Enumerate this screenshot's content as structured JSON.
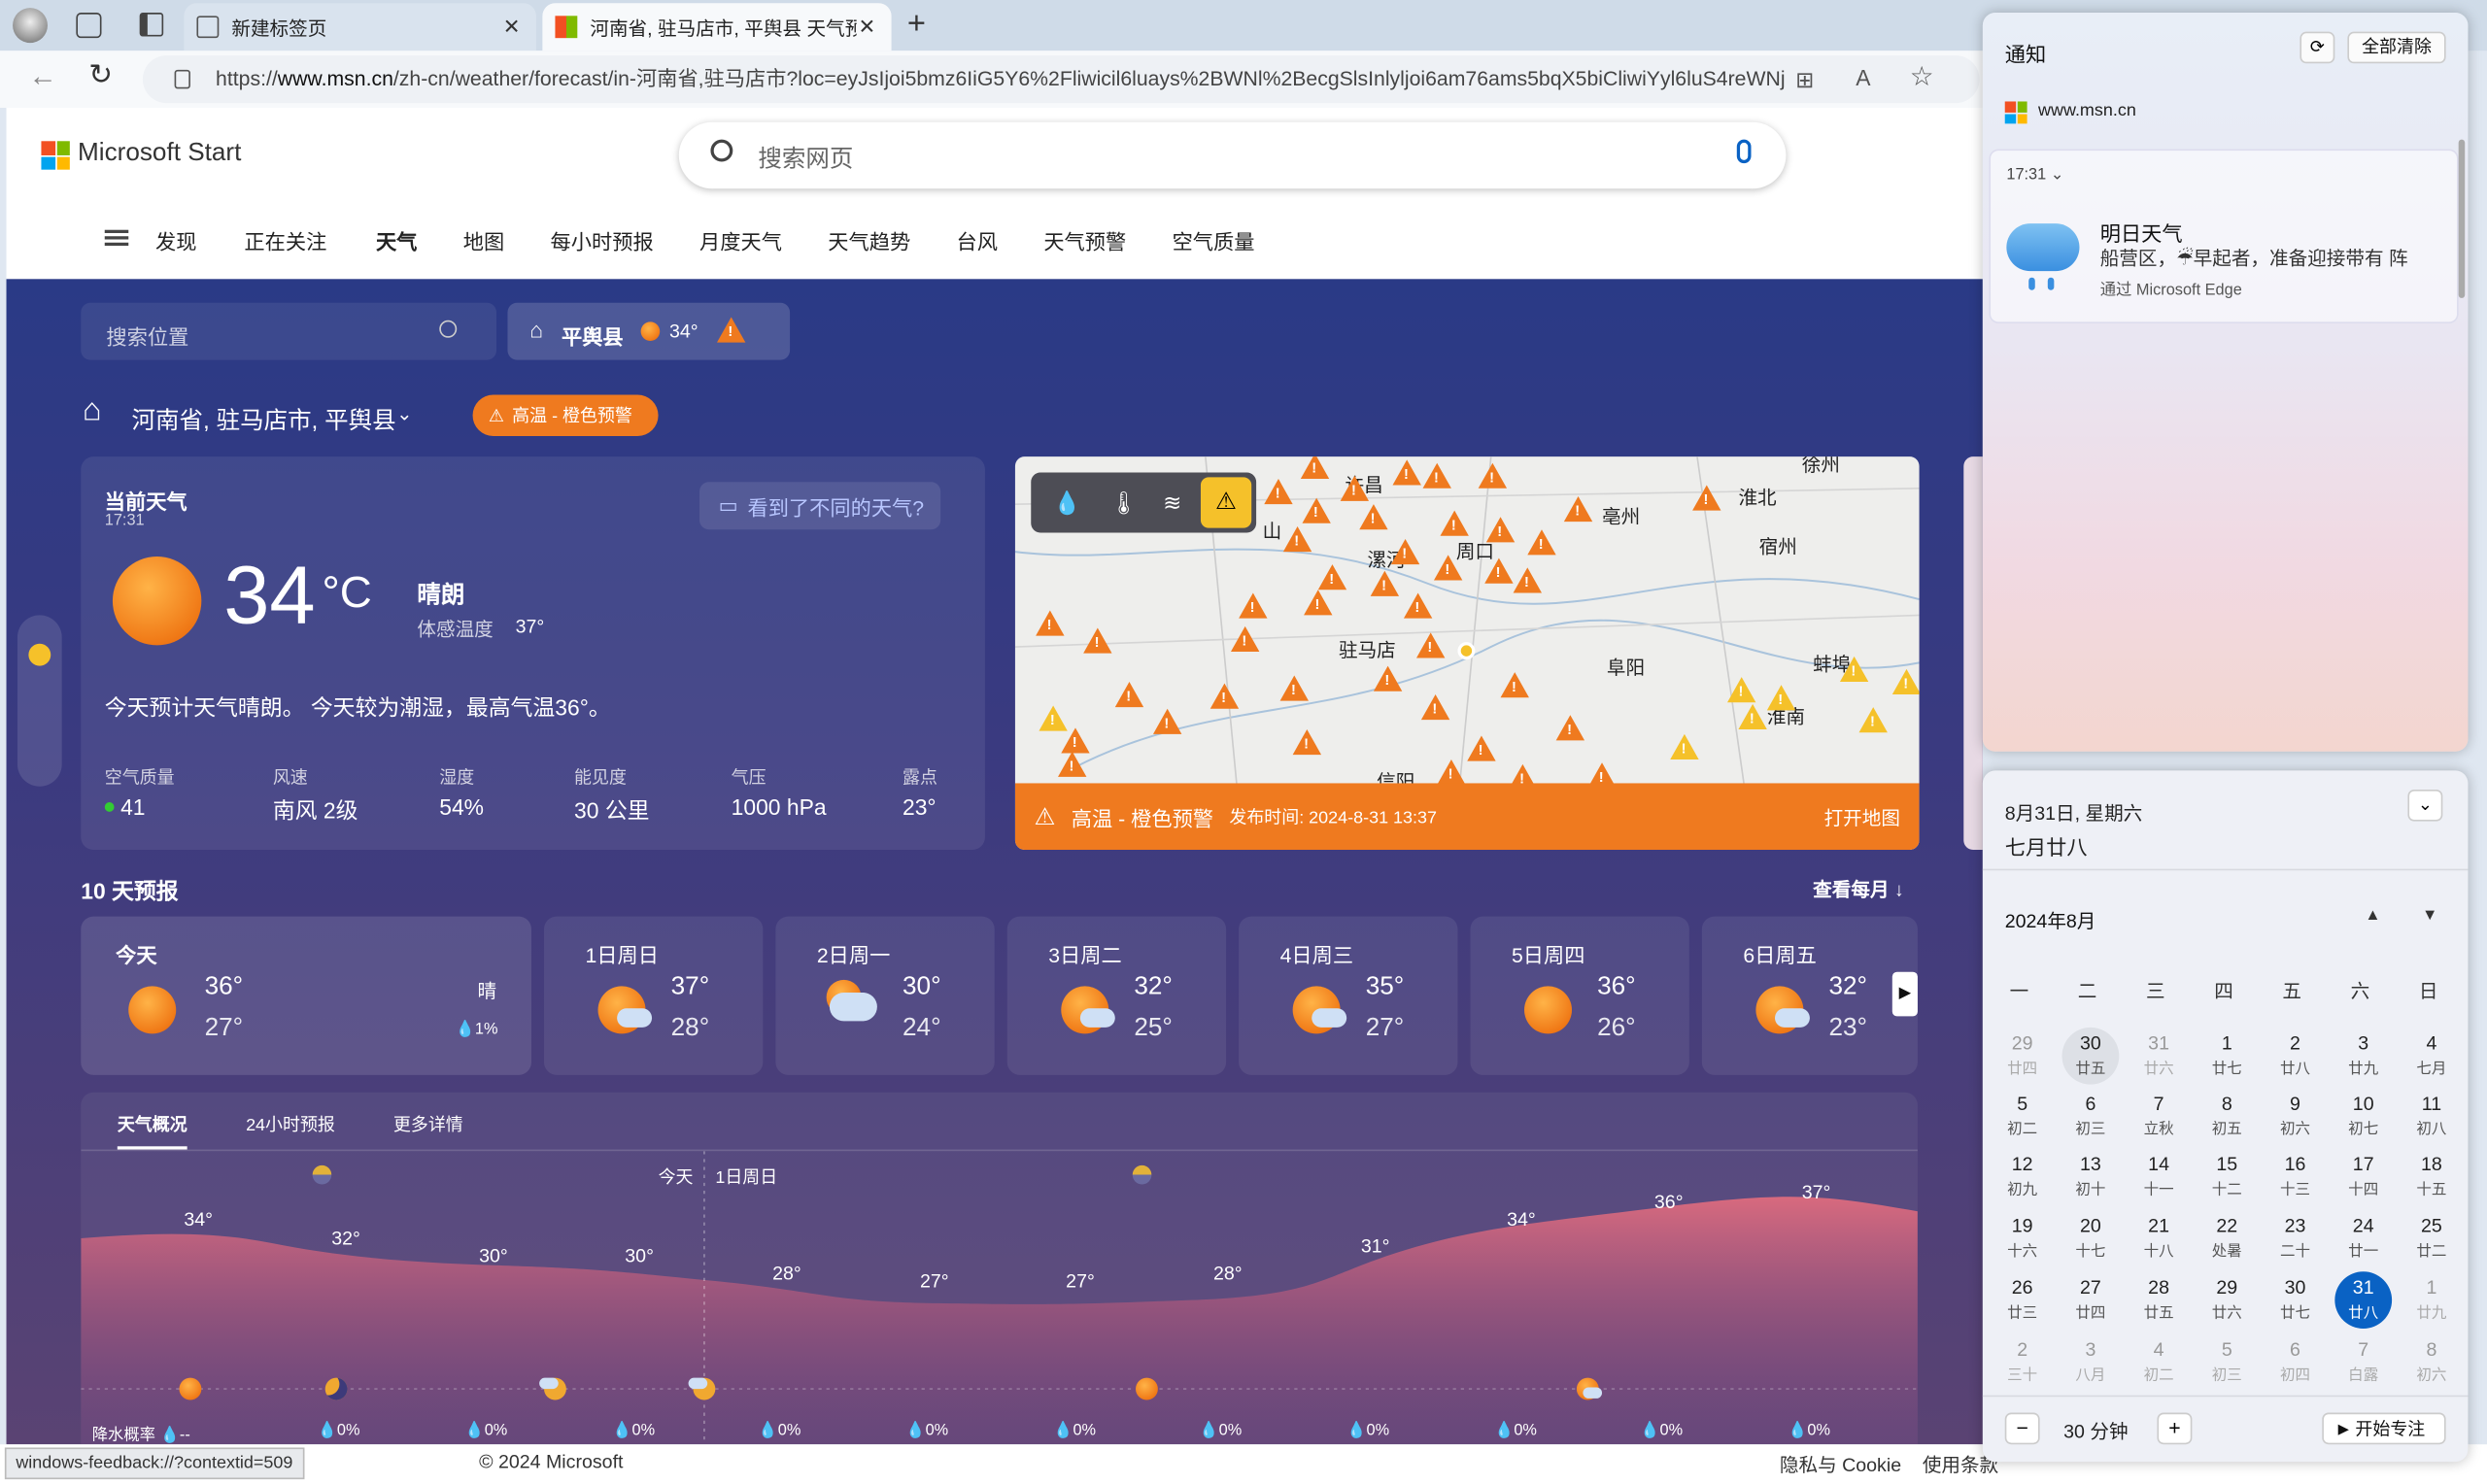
{
  "browser": {
    "tabs": [
      {
        "label": "新建标签页"
      },
      {
        "label": "河南省, 驻马店市, 平舆县 天气预报"
      }
    ],
    "url_prefix": "https://",
    "url_host": "www.msn.cn",
    "url_path": "/zh-cn/weather/forecast/in-河南省,驻马店市?loc=eyJsIjoi5bmz6IiG5Y6%2Fliwicil6luays%2BWNl%2BecgSlsInlyljoi6am76ams5bqX5biCliwiYyl6luS4reWNj..."
  },
  "header": {
    "brand": "Microsoft Start",
    "search_placeholder": "搜索网页",
    "nav": [
      "发现",
      "正在关注",
      "天气",
      "地图",
      "每小时预报",
      "月度天气",
      "天气趋势",
      "台风",
      "天气预警",
      "空气质量"
    ]
  },
  "location": {
    "search_placeholder": "搜索位置",
    "pinned": "平舆县",
    "pinned_temp": "34°",
    "alert_count": "1",
    "title": "河南省, 驻马店市, 平舆县",
    "alert_badge": "高温 - 橙色预警"
  },
  "current": {
    "heading": "当前天气",
    "time": "17:31",
    "feedback": "看到了不同的天气?",
    "temp": "34",
    "unit": "°C",
    "condition": "晴朗",
    "feels_label": "体感温度",
    "feels_value": "37°",
    "summary": "今天预计天气晴朗。 今天较为潮湿，最高气温36°。",
    "stats": [
      {
        "label": "空气质量",
        "value": "41"
      },
      {
        "label": "风速",
        "value": "南风 2级"
      },
      {
        "label": "湿度",
        "value": "54%"
      },
      {
        "label": "能见度",
        "value": "30 公里"
      },
      {
        "label": "气压",
        "value": "1000 hPa"
      },
      {
        "label": "露点",
        "value": "23°"
      }
    ]
  },
  "map": {
    "cities": [
      "许昌",
      "漯河",
      "周口",
      "亳州",
      "淮北",
      "宿州",
      "驻马店",
      "阜阳",
      "蚌埠",
      "淮南",
      "信阳",
      "徐州",
      "山"
    ],
    "alert_text": "高温 - 橙色预警",
    "alert_time": "发布时间: 2024-8-31 13:37",
    "open_map": "打开地图"
  },
  "forecast": {
    "title": "10 天预报",
    "see_monthly": "查看每月",
    "days": [
      {
        "day": "今天",
        "hi": "36°",
        "lo": "27°",
        "cond": "晴",
        "rain": "1%",
        "icon": "sun"
      },
      {
        "day": "1日周日",
        "hi": "37°",
        "lo": "28°",
        "icon": "sun-cloud"
      },
      {
        "day": "2日周一",
        "hi": "30°",
        "lo": "24°",
        "icon": "cloud-sun"
      },
      {
        "day": "3日周二",
        "hi": "32°",
        "lo": "25°",
        "icon": "sun-cloud"
      },
      {
        "day": "4日周三",
        "hi": "35°",
        "lo": "27°",
        "icon": "sun-cloud"
      },
      {
        "day": "5日周四",
        "hi": "36°",
        "lo": "26°",
        "icon": "sun"
      },
      {
        "day": "6日周五",
        "hi": "32°",
        "lo": "23°",
        "icon": "sun-cloud"
      }
    ]
  },
  "overview": {
    "tabs": [
      "天气概况",
      "24小时预报",
      "更多详情"
    ],
    "today_label": "今天",
    "next_label": "1日周日",
    "temps": [
      "34°",
      "32°",
      "30°",
      "30°",
      "28°",
      "27°",
      "27°",
      "28°",
      "31°",
      "34°",
      "36°",
      "37°"
    ],
    "rain_label": "降水概率",
    "rain_first": "--",
    "rain": [
      "0%",
      "0%",
      "0%",
      "0%",
      "0%",
      "0%",
      "0%",
      "0%",
      "0%",
      "0%",
      "0%"
    ]
  },
  "footer": {
    "status_url": "windows-feedback://?contextid=509",
    "copyright": "© 2024 Microsoft",
    "privacy": "隐私与 Cookie",
    "terms": "使用条款"
  },
  "notifications": {
    "title": "通知",
    "clear_all": "全部清除",
    "source": "www.msn.cn",
    "time": "17:31",
    "item_title": "明日天气",
    "item_body": "船营区，☔早起者，准备迎接带有 阵",
    "item_via": "通过 Microsoft Edge"
  },
  "calendar": {
    "date_line": "8月31日, 星期六",
    "lunar_line": "七月廿八",
    "month": "2024年8月",
    "weekdays": [
      "一",
      "二",
      "三",
      "四",
      "五",
      "六",
      "日"
    ],
    "weeks": [
      [
        [
          "29",
          "廿四",
          "o"
        ],
        [
          "30",
          "廿五",
          "t30"
        ],
        [
          "31",
          "廿六",
          "o"
        ],
        [
          "1",
          "廿七",
          ""
        ],
        [
          "2",
          "廿八",
          ""
        ],
        [
          "3",
          "廿九",
          ""
        ],
        [
          "4",
          "七月",
          ""
        ]
      ],
      [
        [
          "5",
          "初二",
          ""
        ],
        [
          "6",
          "初三",
          ""
        ],
        [
          "7",
          "立秋",
          ""
        ],
        [
          "8",
          "初五",
          ""
        ],
        [
          "9",
          "初六",
          ""
        ],
        [
          "10",
          "初七",
          ""
        ],
        [
          "11",
          "初八",
          ""
        ]
      ],
      [
        [
          "12",
          "初九",
          ""
        ],
        [
          "13",
          "初十",
          ""
        ],
        [
          "14",
          "十一",
          ""
        ],
        [
          "15",
          "十二",
          ""
        ],
        [
          "16",
          "十三",
          ""
        ],
        [
          "17",
          "十四",
          ""
        ],
        [
          "18",
          "十五",
          ""
        ]
      ],
      [
        [
          "19",
          "十六",
          ""
        ],
        [
          "20",
          "十七",
          ""
        ],
        [
          "21",
          "十八",
          ""
        ],
        [
          "22",
          "处暑",
          ""
        ],
        [
          "23",
          "二十",
          ""
        ],
        [
          "24",
          "廿一",
          ""
        ],
        [
          "25",
          "廿二",
          ""
        ]
      ],
      [
        [
          "26",
          "廿三",
          ""
        ],
        [
          "27",
          "廿四",
          ""
        ],
        [
          "28",
          "廿五",
          ""
        ],
        [
          "29",
          "廿六",
          ""
        ],
        [
          "30",
          "廿七",
          ""
        ],
        [
          "31",
          "廿八",
          "sel"
        ],
        [
          "1",
          "廿九",
          "o"
        ]
      ],
      [
        [
          "2",
          "三十",
          "o"
        ],
        [
          "3",
          "八月",
          "o"
        ],
        [
          "4",
          "初二",
          "o"
        ],
        [
          "5",
          "初三",
          "o"
        ],
        [
          "6",
          "初四",
          "o"
        ],
        [
          "7",
          "白露",
          "o"
        ],
        [
          "8",
          "初六",
          "o"
        ]
      ]
    ],
    "focus_minutes": "30 分钟",
    "focus_button": "开始专注"
  }
}
